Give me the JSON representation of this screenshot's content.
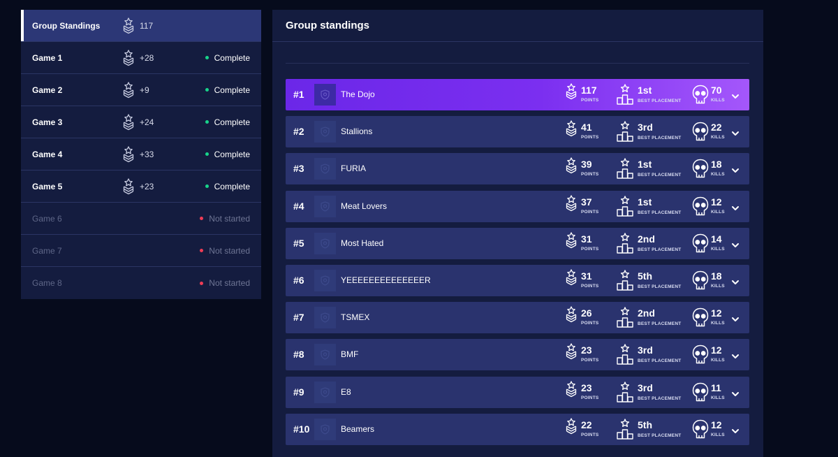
{
  "sidebar": {
    "items": [
      {
        "label": "Group Standings",
        "points": "117",
        "status": "",
        "state": "active"
      },
      {
        "label": "Game 1",
        "points": "+28",
        "status": "Complete",
        "state": "complete"
      },
      {
        "label": "Game 2",
        "points": "+9",
        "status": "Complete",
        "state": "complete"
      },
      {
        "label": "Game 3",
        "points": "+24",
        "status": "Complete",
        "state": "complete"
      },
      {
        "label": "Game 4",
        "points": "+33",
        "status": "Complete",
        "state": "complete"
      },
      {
        "label": "Game 5",
        "points": "+23",
        "status": "Complete",
        "state": "complete"
      },
      {
        "label": "Game 6",
        "points": "",
        "status": "Not started",
        "state": "not-started"
      },
      {
        "label": "Game 7",
        "points": "",
        "status": "Not started",
        "state": "not-started"
      },
      {
        "label": "Game 8",
        "points": "",
        "status": "Not started",
        "state": "not-started"
      }
    ]
  },
  "panel": {
    "title": "Group standings",
    "labels": {
      "points": "POINTS",
      "placement": "BEST PLACEMENT",
      "kills": "KILLS"
    }
  },
  "standings": [
    {
      "rank": "#1",
      "team": "The Dojo",
      "points": "117",
      "placement": "1st",
      "kills": "70"
    },
    {
      "rank": "#2",
      "team": "Stallions",
      "points": "41",
      "placement": "3rd",
      "kills": "22"
    },
    {
      "rank": "#3",
      "team": "FURIA",
      "points": "39",
      "placement": "1st",
      "kills": "18"
    },
    {
      "rank": "#4",
      "team": "Meat Lovers",
      "points": "37",
      "placement": "1st",
      "kills": "12"
    },
    {
      "rank": "#5",
      "team": "Most Hated",
      "points": "31",
      "placement": "2nd",
      "kills": "14"
    },
    {
      "rank": "#6",
      "team": "YEEEEEEEEEEEEEER",
      "points": "31",
      "placement": "5th",
      "kills": "18"
    },
    {
      "rank": "#7",
      "team": "TSMEX",
      "points": "26",
      "placement": "2nd",
      "kills": "12"
    },
    {
      "rank": "#8",
      "team": "BMF",
      "points": "23",
      "placement": "3rd",
      "kills": "12"
    },
    {
      "rank": "#9",
      "team": "E8",
      "points": "23",
      "placement": "3rd",
      "kills": "11"
    },
    {
      "rank": "#10",
      "team": "Beamers",
      "points": "22",
      "placement": "5th",
      "kills": "12"
    }
  ],
  "icons": {
    "points": "points-chevron-icon",
    "placement": "podium-star-icon",
    "kills": "skull-icon",
    "expand": "chevron-down-icon",
    "team_logo": "team-shield-icon"
  },
  "colors": {
    "background": "#060b1c",
    "panel": "#141c3f",
    "row": "#2a336e",
    "leader_row": "#7b2ff0",
    "complete_dot": "#18d38a",
    "not_started_dot": "#ef3c55"
  }
}
